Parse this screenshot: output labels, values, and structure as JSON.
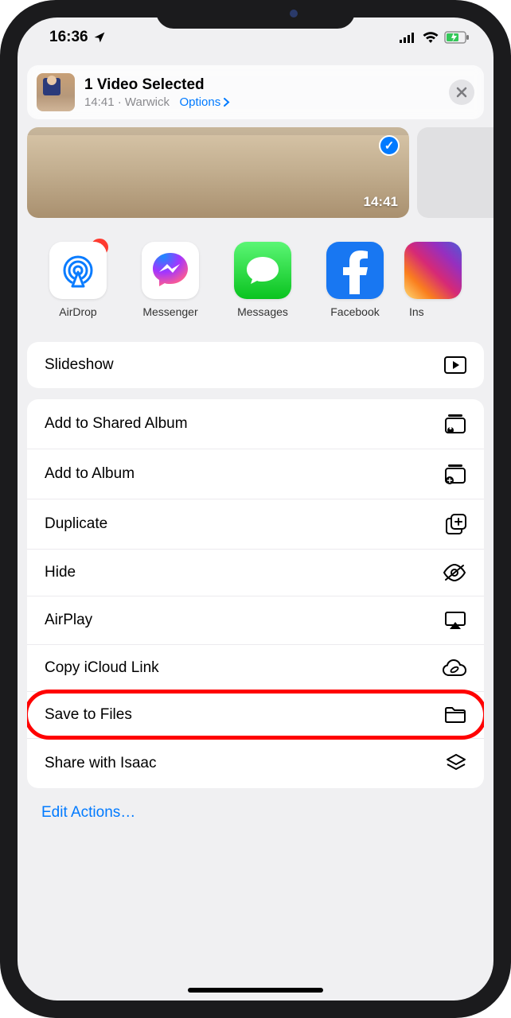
{
  "status": {
    "time": "16:36",
    "location_icon": "location-arrow"
  },
  "header": {
    "title": "1 Video Selected",
    "subtitle_time": "14:41",
    "subtitle_sep": " · ",
    "subtitle_location": "Warwick",
    "options_label": "Options"
  },
  "preview": {
    "time_overlay": "14:41"
  },
  "apps": [
    {
      "name": "AirDrop",
      "icon": "airdrop",
      "badge": "1"
    },
    {
      "name": "Messenger",
      "icon": "messenger",
      "badge": null
    },
    {
      "name": "Messages",
      "icon": "messages",
      "badge": null
    },
    {
      "name": "Facebook",
      "icon": "facebook",
      "badge": null
    },
    {
      "name": "Ins",
      "icon": "instagram",
      "badge": null
    }
  ],
  "single_action": {
    "label": "Slideshow"
  },
  "actions": [
    {
      "label": "Add to Shared Album",
      "icon": "shared-album"
    },
    {
      "label": "Add to Album",
      "icon": "album-add"
    },
    {
      "label": "Duplicate",
      "icon": "duplicate"
    },
    {
      "label": "Hide",
      "icon": "eye-slash"
    },
    {
      "label": "AirPlay",
      "icon": "airplay"
    },
    {
      "label": "Copy iCloud Link",
      "icon": "icloud-link"
    },
    {
      "label": "Save to Files",
      "icon": "folder"
    },
    {
      "label": "Share with Isaac",
      "icon": "stack"
    }
  ],
  "footer": {
    "edit_actions": "Edit Actions…"
  },
  "highlight_index": 6
}
